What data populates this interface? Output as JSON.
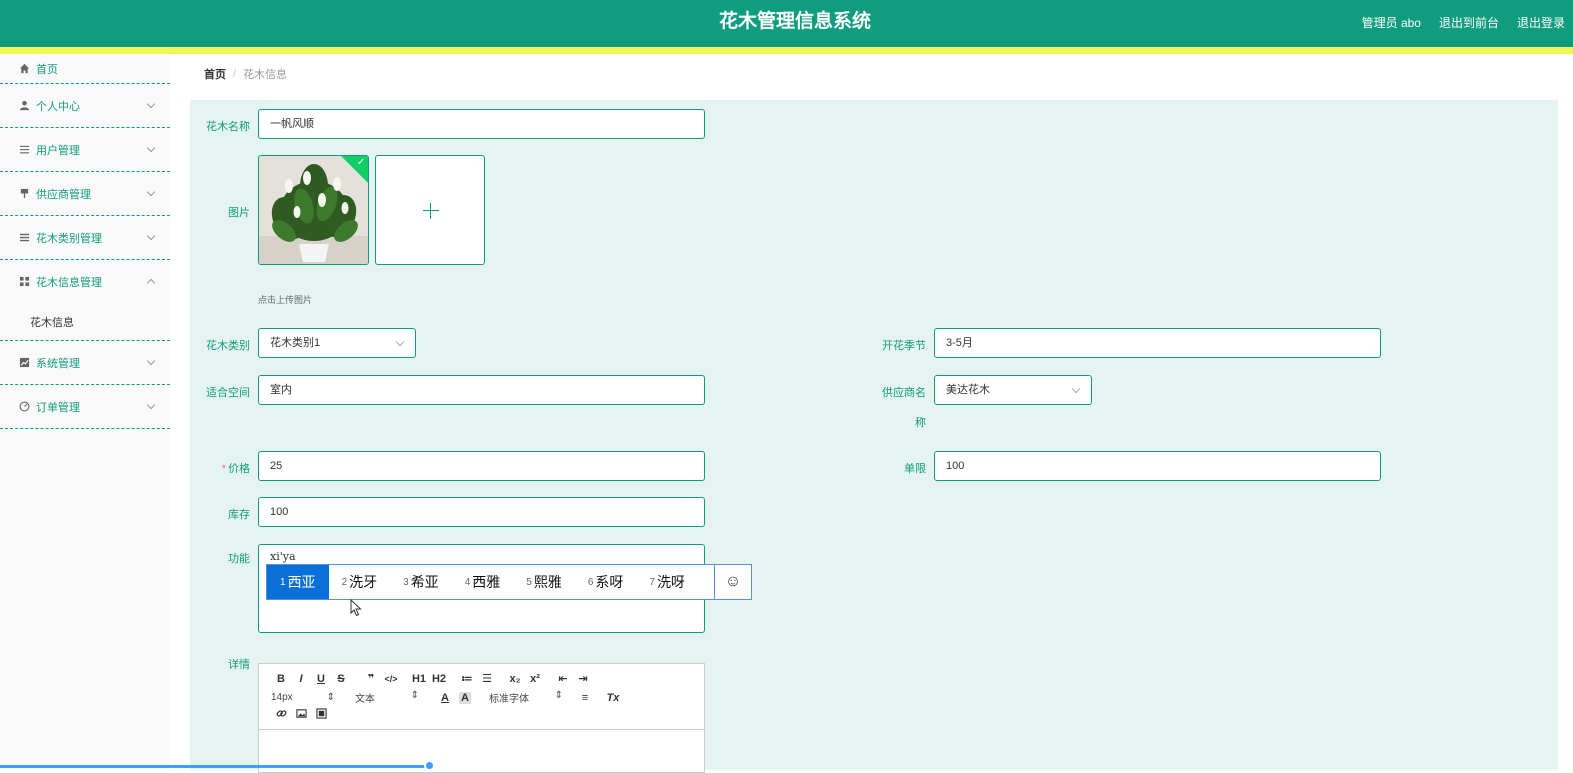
{
  "header": {
    "title": "花木管理信息系统",
    "user": "管理员 abo",
    "to_front": "退出到前台",
    "logout": "退出登录"
  },
  "sidebar": {
    "items": [
      {
        "label": "首页",
        "icon": "home-icon"
      },
      {
        "label": "个人中心",
        "icon": "user-icon"
      },
      {
        "label": "用户管理",
        "icon": "list-icon"
      },
      {
        "label": "供应商管理",
        "icon": "pin-icon"
      },
      {
        "label": "花木类别管理",
        "icon": "menu-icon"
      },
      {
        "label": "花木信息管理",
        "icon": "grid-icon",
        "expanded": true
      },
      {
        "label": "系统管理",
        "icon": "chart-icon"
      },
      {
        "label": "订单管理",
        "icon": "gauge-icon"
      }
    ],
    "submenu": "花木信息"
  },
  "breadcrumb": {
    "home": "首页",
    "separator": "/",
    "current": "花木信息"
  },
  "form": {
    "name_label": "花木名称",
    "name_value": "一帆风顺",
    "image_label": "图片",
    "upload_tip": "点击上传图片",
    "category_label": "花木类别",
    "category_value": "花木类别1",
    "season_label": "开花季节",
    "season_value": "3-5月",
    "space_label": "适合空间",
    "space_value": "室内",
    "supplier_label_1": "供应商名",
    "supplier_label_2": "称",
    "supplier_value": "美达花木",
    "price_required": "*",
    "price_label": "价格",
    "price_value": "25",
    "limit_label": "单限",
    "limit_value": "100",
    "stock_label": "库存",
    "stock_value": "100",
    "function_label": "功能",
    "function_value": "xi'ya",
    "detail_label": "详情"
  },
  "ime": {
    "candidates": [
      {
        "n": "1",
        "text": "西亚"
      },
      {
        "n": "2",
        "text": "洗牙"
      },
      {
        "n": "3",
        "text": "希亚"
      },
      {
        "n": "4",
        "text": "西雅"
      },
      {
        "n": "5",
        "text": "熙雅"
      },
      {
        "n": "6",
        "text": "系呀"
      },
      {
        "n": "7",
        "text": "洗呀"
      }
    ],
    "emoji": "☺"
  },
  "editor": {
    "row1": [
      "B",
      "I",
      "U",
      "S",
      "❞",
      "</>",
      "H1",
      "H2",
      "≔",
      "☰",
      "x₂",
      "x²",
      "⇤",
      "⇥"
    ],
    "font_size": "14px",
    "text_style": "文本",
    "font_family": "标准字体",
    "align_icon": "≡",
    "clear_icon": "Tx",
    "color_icon": "A",
    "bg_icon": "A"
  },
  "colors": {
    "primary": "#109c7e",
    "stripe": "#f3f556",
    "form_bg": "#e6f4f1",
    "ime_active": "#0a6fd8"
  }
}
